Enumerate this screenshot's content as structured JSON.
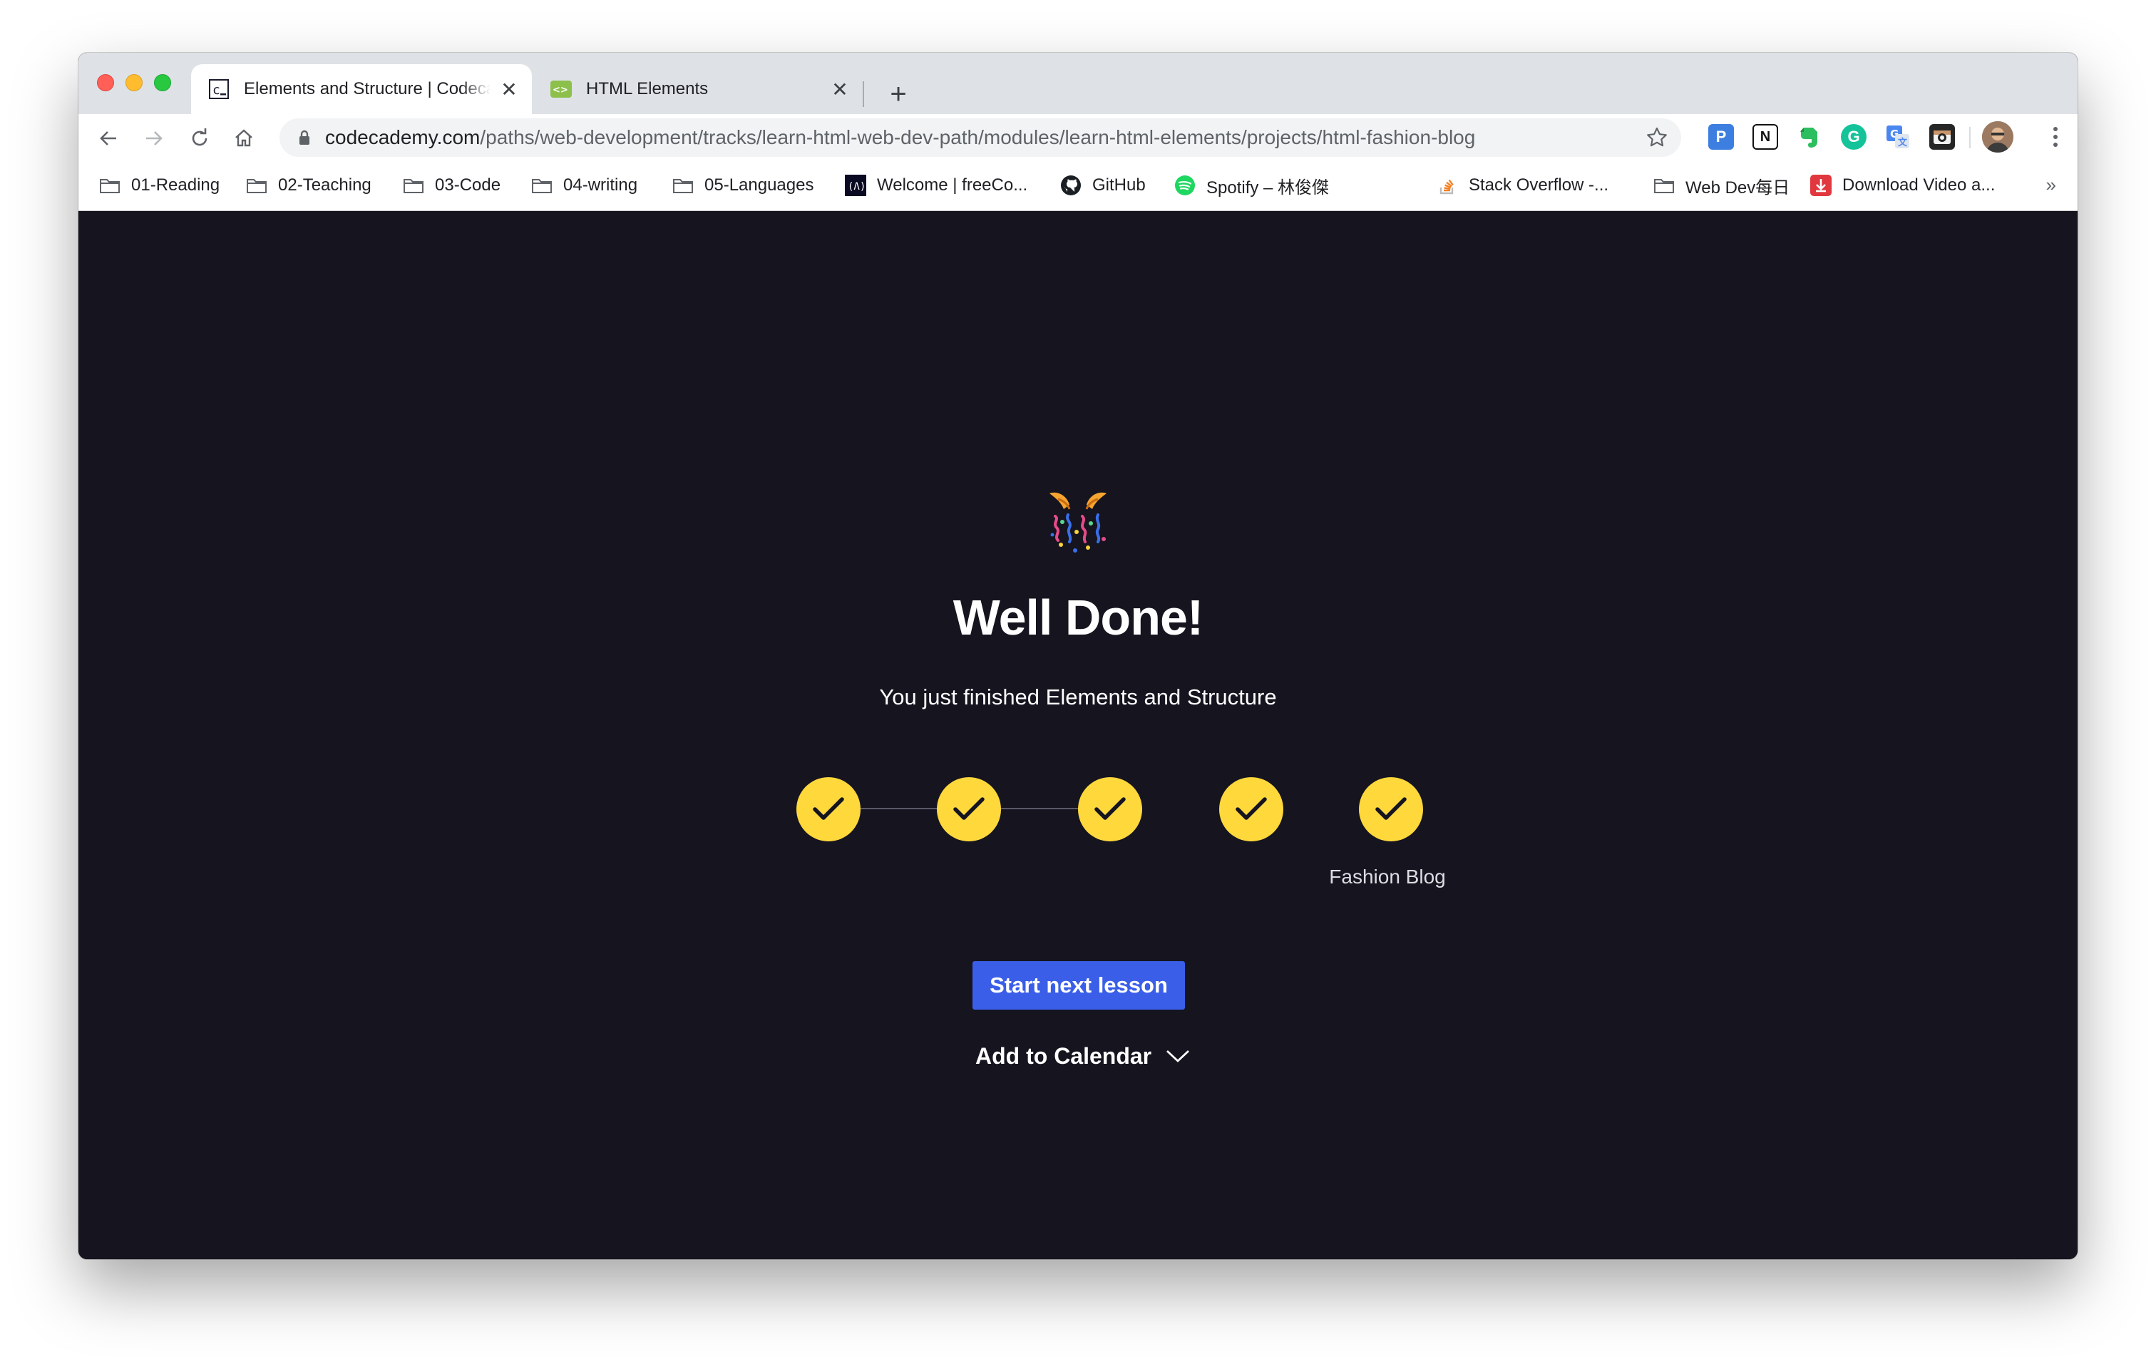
{
  "browser": {
    "tabs": [
      {
        "title": "Elements and Structure | Codecademy",
        "icon": "codecademy-icon",
        "active": true
      },
      {
        "title": "HTML Elements",
        "icon": "html-elements-icon",
        "active": false
      }
    ],
    "new_tab_label": "+",
    "url": {
      "host": "codecademy.com",
      "path": "/paths/web-development/tracks/learn-html-web-dev-path/modules/learn-html-elements/projects/html-fashion-blog"
    },
    "extensions": [
      "p-icon",
      "notion-icon",
      "evernote-icon",
      "grammarly-icon",
      "translate-icon",
      "camera-icon",
      "avatar"
    ],
    "bookmarks": [
      {
        "label": "01-Reading",
        "icon": "folder-icon"
      },
      {
        "label": "02-Teaching",
        "icon": "folder-icon"
      },
      {
        "label": "03-Code",
        "icon": "folder-icon"
      },
      {
        "label": "04-writing",
        "icon": "folder-icon"
      },
      {
        "label": "05-Languages",
        "icon": "folder-icon"
      },
      {
        "label": "Welcome | freeCo...",
        "icon": "freecodecamp-icon"
      },
      {
        "label": "GitHub",
        "icon": "github-icon"
      },
      {
        "label": "Spotify – 林俊傑",
        "icon": "spotify-icon"
      },
      {
        "label": "Stack Overflow -...",
        "icon": "stackoverflow-icon"
      },
      {
        "label": "Web Dev每日",
        "icon": "folder-icon"
      },
      {
        "label": "Download Video a...",
        "icon": "download-icon"
      }
    ],
    "bookmarks_more": "»"
  },
  "page": {
    "icon": "party-popper-icon",
    "headline": "Well Done!",
    "subline": "You just finished Elements and Structure",
    "steps_completed": 5,
    "steps_total": 5,
    "last_step_label": "Fashion Blog",
    "next_button": "Start next lesson",
    "calendar_label": "Add to Calendar"
  },
  "colors": {
    "page_bg": "#15141f",
    "step_yellow": "#ffd83c",
    "button_blue": "#3a5ee8"
  }
}
